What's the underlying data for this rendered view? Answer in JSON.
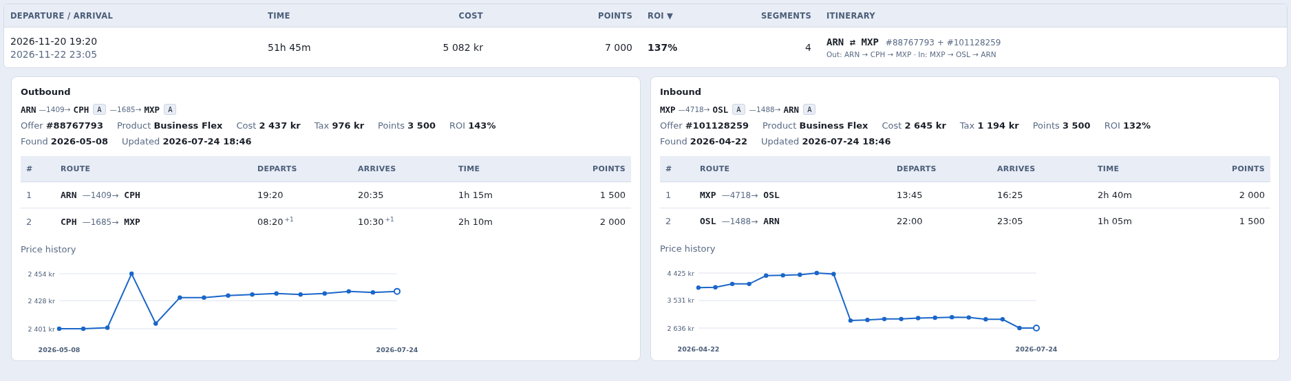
{
  "summary_table": {
    "columns": [
      {
        "label": "DEPARTURE / ARRIVAL"
      },
      {
        "label": "TIME"
      },
      {
        "label": "COST"
      },
      {
        "label": "POINTS"
      },
      {
        "label": "ROI ▼"
      },
      {
        "label": "SEGMENTS"
      },
      {
        "label": "ITINERARY"
      }
    ],
    "row": {
      "departure": "2026-11-20 19:20",
      "arrival": "2026-11-22 23:05",
      "time": "51h 45m",
      "cost": "5 082 kr",
      "points": "7 000",
      "roi": "137%",
      "segments": "4",
      "itinerary": {
        "route": "ARN ⇄ MXP",
        "offers": "#88767793 + #101128259",
        "detail": "Out: ARN → CPH → MXP · In: MXP → OSL → ARN"
      }
    }
  },
  "legs": [
    {
      "title": "Outbound",
      "route": {
        "origin": "ARN",
        "hops": [
          {
            "flight": "—1409→",
            "code": "CPH",
            "badge": "A"
          },
          {
            "flight": "—1685→",
            "code": "MXP",
            "badge": "A"
          }
        ]
      },
      "facts": [
        {
          "label": "Offer",
          "value": "#88767793"
        },
        {
          "label": "Product",
          "value": "Business Flex"
        },
        {
          "label": "Cost",
          "value": "2 437 kr"
        },
        {
          "label": "Tax",
          "value": "976 kr"
        },
        {
          "label": "Points",
          "value": "3 500"
        },
        {
          "label": "ROI",
          "value": "143%"
        },
        {
          "label": "Found",
          "value": "2026-05-08"
        },
        {
          "label": "Updated",
          "value": "2026-07-24 18:46"
        }
      ],
      "table": {
        "columns": [
          {
            "label": "#"
          },
          {
            "label": "ROUTE"
          },
          {
            "label": "DEPARTS"
          },
          {
            "label": "ARRIVES"
          },
          {
            "label": "TIME"
          },
          {
            "label": "POINTS"
          }
        ],
        "rows": [
          {
            "index": "1",
            "from": "ARN",
            "flight": "—1409→",
            "to": "CPH",
            "departs": "19:20",
            "arrives": "20:35",
            "time": "1h 15m",
            "points": "1 500"
          },
          {
            "index": "2",
            "from": "CPH",
            "flight": "—1685→",
            "to": "MXP",
            "departs": "08:20",
            "departs_day": "+1",
            "arrives": "10:30",
            "arrives_day": "+1",
            "time": "2h 10m",
            "points": "2 000"
          }
        ]
      },
      "price_history": {
        "chart_data": {
          "type": "line",
          "title": "Price history",
          "grid": true,
          "categories": [
            "2026-05-08",
            null,
            null,
            null,
            null,
            null,
            null,
            null,
            null,
            null,
            null,
            null,
            null,
            null,
            "2026-07-24"
          ],
          "series": [
            {
              "color": "#1a66c9",
              "marker": "circle",
              "values": [
                2401,
                2401,
                2402,
                2454,
                2406,
                2431,
                2431,
                2433,
                2434,
                2435,
                2434,
                2435,
                2437,
                2436,
                2437
              ]
            }
          ],
          "ylim": [
            2401,
            2454
          ],
          "yticks": [
            {
              "value": 2401,
              "label": "2 401 kr"
            },
            {
              "value": 2428,
              "label": "2 428 kr"
            },
            {
              "value": 2454,
              "label": "2 454 kr"
            }
          ]
        }
      }
    },
    {
      "title": "Inbound",
      "route": {
        "origin": "MXP",
        "hops": [
          {
            "flight": "—4718→",
            "code": "OSL",
            "badge": "A"
          },
          {
            "flight": "—1488→",
            "code": "ARN",
            "badge": "A"
          }
        ]
      },
      "facts": [
        {
          "label": "Offer",
          "value": "#101128259"
        },
        {
          "label": "Product",
          "value": "Business Flex"
        },
        {
          "label": "Cost",
          "value": "2 645 kr"
        },
        {
          "label": "Tax",
          "value": "1 194 kr"
        },
        {
          "label": "Points",
          "value": "3 500"
        },
        {
          "label": "ROI",
          "value": "132%"
        },
        {
          "label": "Found",
          "value": "2026-04-22"
        },
        {
          "label": "Updated",
          "value": "2026-07-24 18:46"
        }
      ],
      "table": {
        "columns": [
          {
            "label": "#"
          },
          {
            "label": "ROUTE"
          },
          {
            "label": "DEPARTS"
          },
          {
            "label": "ARRIVES"
          },
          {
            "label": "TIME"
          },
          {
            "label": "POINTS"
          }
        ],
        "rows": [
          {
            "index": "1",
            "from": "MXP",
            "flight": "—4718→",
            "to": "OSL",
            "departs": "13:45",
            "arrives": "16:25",
            "time": "2h 40m",
            "points": "2 000"
          },
          {
            "index": "2",
            "from": "OSL",
            "flight": "—1488→",
            "to": "ARN",
            "departs": "22:00",
            "arrives": "23:05",
            "time": "1h 05m",
            "points": "1 500"
          }
        ]
      },
      "price_history": {
        "chart_data": {
          "type": "line",
          "title": "Price history",
          "grid": true,
          "categories": [
            "2026-04-22",
            null,
            null,
            null,
            null,
            null,
            null,
            null,
            null,
            null,
            null,
            null,
            null,
            null,
            null,
            null,
            null,
            null,
            null,
            null,
            "2026-07-24"
          ],
          "series": [
            {
              "color": "#1a66c9",
              "marker": "circle",
              "values": [
                3950,
                3960,
                4070,
                4070,
                4340,
                4350,
                4370,
                4425,
                4390,
                2880,
                2900,
                2930,
                2930,
                2960,
                2970,
                2990,
                2980,
                2920,
                2920,
                2636,
                2636
              ]
            }
          ],
          "ylim": [
            2636,
            4425
          ],
          "yticks": [
            {
              "value": 2636,
              "label": "2 636 kr"
            },
            {
              "value": 3531,
              "label": "3 531 kr"
            },
            {
              "value": 4425,
              "label": "4 425 kr"
            }
          ]
        }
      }
    }
  ]
}
